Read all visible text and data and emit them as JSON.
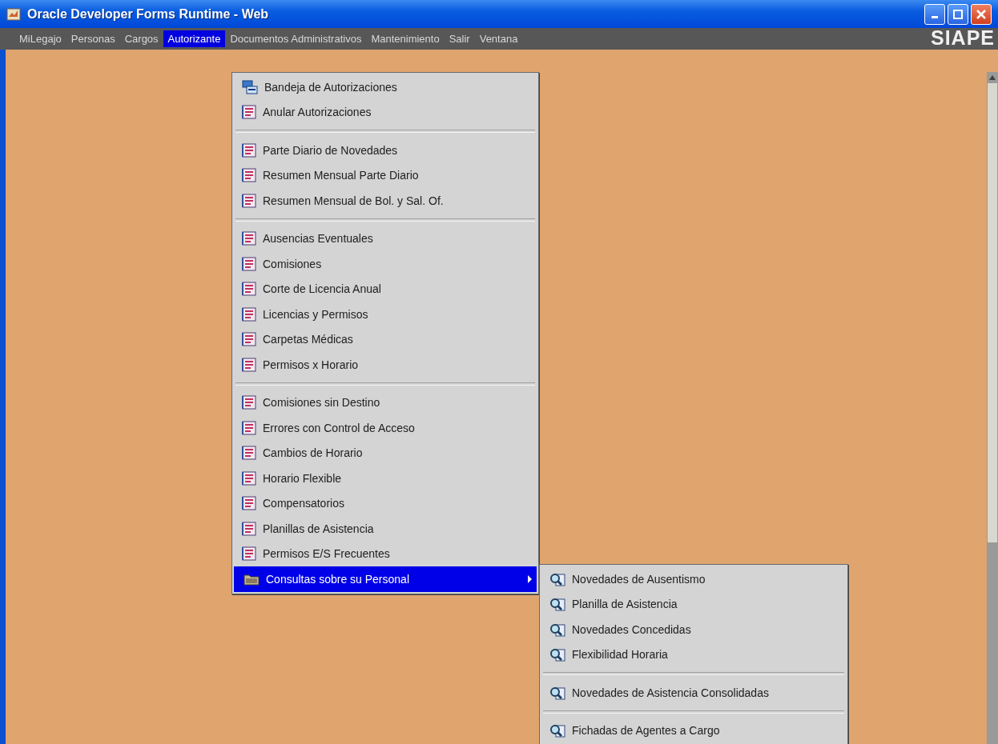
{
  "window": {
    "title": "Oracle Developer Forms Runtime - Web",
    "logo": "SIAPE"
  },
  "menu_bar": [
    {
      "label": "MiLegajo",
      "selected": false
    },
    {
      "label": "Personas",
      "selected": false
    },
    {
      "label": "Cargos",
      "selected": false
    },
    {
      "label": "Autorizante",
      "selected": true
    },
    {
      "label": "Documentos Administrativos",
      "selected": false
    },
    {
      "label": "Mantenimiento",
      "selected": false
    },
    {
      "label": "Salir",
      "selected": false
    },
    {
      "label": "Ventana",
      "selected": false
    }
  ],
  "menu": [
    {
      "kind": "tray",
      "label": "Bandeja de Autorizaciones",
      "selected": false
    },
    {
      "kind": "form",
      "label": "Anular Autorizaciones",
      "selected": false
    },
    {
      "kind": "separator"
    },
    {
      "kind": "form",
      "label": "Parte Diario de Novedades",
      "selected": false
    },
    {
      "kind": "form",
      "label": "Resumen Mensual Parte Diario",
      "selected": false
    },
    {
      "kind": "form",
      "label": "Resumen Mensual de Bol. y Sal. Of.",
      "selected": false
    },
    {
      "kind": "separator"
    },
    {
      "kind": "form",
      "label": "Ausencias Eventuales",
      "selected": false
    },
    {
      "kind": "form",
      "label": "Comisiones",
      "selected": false
    },
    {
      "kind": "form",
      "label": "Corte de Licencia Anual",
      "selected": false
    },
    {
      "kind": "form",
      "label": "Licencias y Permisos",
      "selected": false
    },
    {
      "kind": "form",
      "label": "Carpetas Médicas",
      "selected": false
    },
    {
      "kind": "form",
      "label": "Permisos x Horario",
      "selected": false
    },
    {
      "kind": "separator"
    },
    {
      "kind": "form",
      "label": "Comisiones sin Destino",
      "selected": false
    },
    {
      "kind": "form",
      "label": "Errores con Control de Acceso",
      "selected": false
    },
    {
      "kind": "form",
      "label": "Cambios de Horario",
      "selected": false
    },
    {
      "kind": "form",
      "label": "Horario Flexible",
      "selected": false
    },
    {
      "kind": "form",
      "label": "Compensatorios",
      "selected": false
    },
    {
      "kind": "form",
      "label": "Planillas de Asistencia",
      "selected": false
    },
    {
      "kind": "form",
      "label": "Permisos E/S Frecuentes",
      "selected": false
    },
    {
      "kind": "folder",
      "label": "Consultas sobre su Personal",
      "selected": true
    }
  ],
  "submenu": [
    {
      "kind": "query",
      "label": "Novedades de Ausentismo",
      "selected": false
    },
    {
      "kind": "query",
      "label": "Planilla de Asistencia",
      "selected": false
    },
    {
      "kind": "query",
      "label": "Novedades Concedidas",
      "selected": false
    },
    {
      "kind": "query",
      "label": "Flexibilidad Horaria",
      "selected": false
    },
    {
      "kind": "separator"
    },
    {
      "kind": "query",
      "label": "Novedades de Asistencia Consolidadas",
      "selected": false
    },
    {
      "kind": "separator"
    },
    {
      "kind": "query",
      "label": "Fichadas de Agentes a Cargo",
      "selected": false
    }
  ]
}
